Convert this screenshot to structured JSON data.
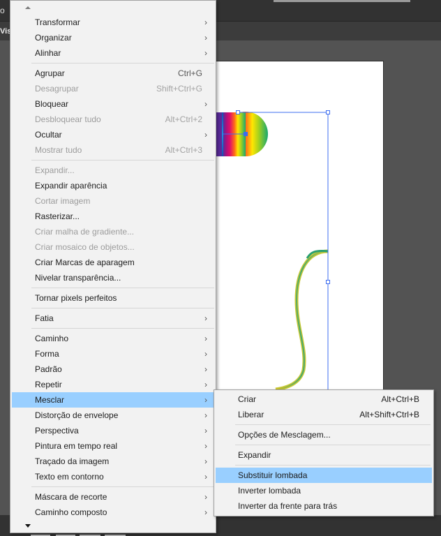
{
  "app": {
    "top_fragment": "o",
    "tab_fragment": "Vis"
  },
  "main_menu": {
    "groups": [
      [
        {
          "label": "Transformar",
          "shortcut": "",
          "submenu": true,
          "disabled": false
        },
        {
          "label": "Organizar",
          "shortcut": "",
          "submenu": true,
          "disabled": false
        },
        {
          "label": "Alinhar",
          "shortcut": "",
          "submenu": true,
          "disabled": false
        }
      ],
      [
        {
          "label": "Agrupar",
          "shortcut": "Ctrl+G",
          "submenu": false,
          "disabled": false
        },
        {
          "label": "Desagrupar",
          "shortcut": "Shift+Ctrl+G",
          "submenu": false,
          "disabled": true
        },
        {
          "label": "Bloquear",
          "shortcut": "",
          "submenu": true,
          "disabled": false
        },
        {
          "label": "Desbloquear tudo",
          "shortcut": "Alt+Ctrl+2",
          "submenu": false,
          "disabled": true
        },
        {
          "label": "Ocultar",
          "shortcut": "",
          "submenu": true,
          "disabled": false
        },
        {
          "label": "Mostrar tudo",
          "shortcut": "Alt+Ctrl+3",
          "submenu": false,
          "disabled": true
        }
      ],
      [
        {
          "label": "Expandir...",
          "shortcut": "",
          "submenu": false,
          "disabled": true
        },
        {
          "label": "Expandir aparência",
          "shortcut": "",
          "submenu": false,
          "disabled": false
        },
        {
          "label": "Cortar imagem",
          "shortcut": "",
          "submenu": false,
          "disabled": true
        },
        {
          "label": "Rasterizar...",
          "shortcut": "",
          "submenu": false,
          "disabled": false
        },
        {
          "label": "Criar malha de gradiente...",
          "shortcut": "",
          "submenu": false,
          "disabled": true
        },
        {
          "label": "Criar mosaico de objetos...",
          "shortcut": "",
          "submenu": false,
          "disabled": true
        },
        {
          "label": "Criar Marcas de aparagem",
          "shortcut": "",
          "submenu": false,
          "disabled": false
        },
        {
          "label": "Nivelar transparência...",
          "shortcut": "",
          "submenu": false,
          "disabled": false
        }
      ],
      [
        {
          "label": "Tornar pixels perfeitos",
          "shortcut": "",
          "submenu": false,
          "disabled": false
        }
      ],
      [
        {
          "label": "Fatia",
          "shortcut": "",
          "submenu": true,
          "disabled": false
        }
      ],
      [
        {
          "label": "Caminho",
          "shortcut": "",
          "submenu": true,
          "disabled": false
        },
        {
          "label": "Forma",
          "shortcut": "",
          "submenu": true,
          "disabled": false
        },
        {
          "label": "Padrão",
          "shortcut": "",
          "submenu": true,
          "disabled": false
        },
        {
          "label": "Repetir",
          "shortcut": "",
          "submenu": true,
          "disabled": false
        },
        {
          "label": "Mesclar",
          "shortcut": "",
          "submenu": true,
          "disabled": false,
          "highlighted": true
        },
        {
          "label": "Distorção de envelope",
          "shortcut": "",
          "submenu": true,
          "disabled": false
        },
        {
          "label": "Perspectiva",
          "shortcut": "",
          "submenu": true,
          "disabled": false
        },
        {
          "label": "Pintura em tempo real",
          "shortcut": "",
          "submenu": true,
          "disabled": false
        },
        {
          "label": "Traçado da imagem",
          "shortcut": "",
          "submenu": true,
          "disabled": false
        },
        {
          "label": "Texto em contorno",
          "shortcut": "",
          "submenu": true,
          "disabled": false
        }
      ],
      [
        {
          "label": "Máscara de recorte",
          "shortcut": "",
          "submenu": true,
          "disabled": false
        },
        {
          "label": "Caminho composto",
          "shortcut": "",
          "submenu": true,
          "disabled": false
        }
      ]
    ]
  },
  "submenu": {
    "groups": [
      [
        {
          "label": "Criar",
          "shortcut": "Alt+Ctrl+B"
        },
        {
          "label": "Liberar",
          "shortcut": "Alt+Shift+Ctrl+B"
        }
      ],
      [
        {
          "label": "Opções de Mesclagem...",
          "shortcut": ""
        }
      ],
      [
        {
          "label": "Expandir",
          "shortcut": ""
        }
      ],
      [
        {
          "label": "Substituir lombada",
          "shortcut": "",
          "highlighted": true
        },
        {
          "label": "Inverter lombada",
          "shortcut": ""
        },
        {
          "label": "Inverter da frente para trás",
          "shortcut": ""
        }
      ]
    ]
  },
  "colors": {
    "highlight": "#99cfff",
    "menu_bg": "#f2f2f2",
    "selection": "#3c6cf0"
  }
}
